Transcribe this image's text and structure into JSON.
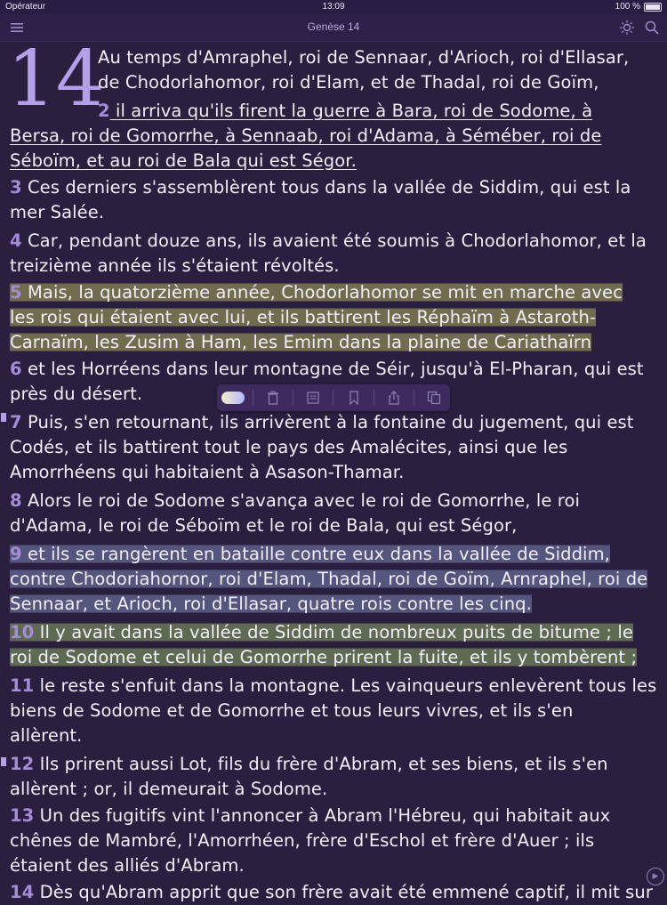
{
  "status": {
    "carrier": "Opérateur",
    "time": "13:09",
    "battery": "100 %"
  },
  "navbar": {
    "title": "Genèse 14"
  },
  "chapter": {
    "number": "14",
    "verses": [
      {
        "n": "",
        "text": "Au temps d'Amraphel, roi de Sennaar, d'Arioch, roi d'Ellasar,"
      },
      {
        "n": "",
        "text": "de Chodorlahomor, roi d'Elam, et de Thadal, roi de Goïm,"
      },
      {
        "n": "2",
        "text": " il arriva qu'ils firent la guerre à Bara, roi de Sodome, à"
      },
      {
        "n": "",
        "text": "Bersa, roi de Gomorrhe, à Sennaab, roi d'Adama, à Séméber, roi de"
      },
      {
        "n": "",
        "text": "Séboïm, et au roi de Bala qui est Ségor."
      },
      {
        "n": "3",
        "text": " Ces derniers s'assemblèrent tous dans la vallée de Siddim, qui est la"
      },
      {
        "n": "",
        "text": "mer Salée."
      },
      {
        "n": "4",
        "text": " Car, pendant douze ans, ils avaient été soumis à Chodorlahomor, et la"
      },
      {
        "n": "",
        "text": "treizième année ils s'étaient révoltés."
      },
      {
        "n": "5",
        "text": " Mais, la quatorzième année, Chodorlahomor se mit en marche avec"
      },
      {
        "n": "",
        "text": "les rois qui étaient avec lui, et ils battirent les Réphaïm à Astaroth-"
      },
      {
        "n": "",
        "text": "Carnaïm, les Zusim à Ham, les Emim dans la plaine de Cariathaïrn"
      },
      {
        "n": "6",
        "text": " et les Horréens dans leur montagne de Séir, jusqu'à El-Pharan, qui est"
      },
      {
        "n": "",
        "text": "près du désert."
      },
      {
        "n": "7",
        "text": " Puis, s'en retournant, ils arrivèrent à la fontaine du jugement, qui est"
      },
      {
        "n": "",
        "text": "Codés, et ils battirent tout le pays des Amalécites, ainsi que les"
      },
      {
        "n": "",
        "text": "Amorrhéens qui habitaient à Asason-Thamar."
      },
      {
        "n": "8",
        "text": " Alors le roi de Sodome s'avança avec le roi de Gomorrhe, le roi"
      },
      {
        "n": "",
        "text": "d'Adama, le roi de Séboïm et le roi de Bala, qui est Ségor,"
      },
      {
        "n": "9",
        "text": " et ils se rangèrent en bataille contre eux dans la vallée de Siddim,"
      },
      {
        "n": "",
        "text": "contre Chodoriahornor, roi d'Elam, Thadal, roi de Goïm, Arnraphel, roi de"
      },
      {
        "n": "",
        "text": "Sennaar, et Arioch, roi d'Ellasar, quatre rois contre les cinq."
      },
      {
        "n": "10",
        "text": " Il y avait dans la vallée de Siddim de nombreux puits de bitume ; le"
      },
      {
        "n": "",
        "text": "roi de Sodome et celui de Gomorrhe prirent la fuite, et ils y tombèrent ;"
      },
      {
        "n": "11",
        "text": " le reste s'enfuit dans la montagne. Les vainqueurs enlevèrent tous les"
      },
      {
        "n": "",
        "text": "biens de Sodome et de Gomorrhe et tous leurs vivres, et ils s'en"
      },
      {
        "n": "",
        "text": "allèrent."
      },
      {
        "n": "12",
        "text": " Ils prirent aussi Lot, fils du frère d'Abram, et ses biens, et ils s'en"
      },
      {
        "n": "",
        "text": "allèrent ; or, il demeurait à Sodome."
      },
      {
        "n": "13",
        "text": " Un des fugitifs vint l'annoncer à Abram l'Hébreu, qui habitait aux"
      },
      {
        "n": "",
        "text": "chênes de Mambré, l'Amorrhéen, frère d'Eschol et frère d'Auer ; ils"
      },
      {
        "n": "",
        "text": "étaient des alliés d'Abram."
      },
      {
        "n": "14",
        "text": " Dès qu'Abram apprit que son frère avait été emmené captif, il mit sur"
      }
    ]
  },
  "toolbar": {
    "items": [
      "toggle-icon",
      "trash-icon",
      "note-icon",
      "bookmark-icon",
      "share-icon",
      "copy-icon"
    ]
  },
  "colors": {
    "background": "#2b1f40",
    "highlight_yellow": "#abac5a",
    "highlight_blue": "#707aa8",
    "highlight_green": "#809c5c",
    "verse_number": "#a38dd6"
  }
}
